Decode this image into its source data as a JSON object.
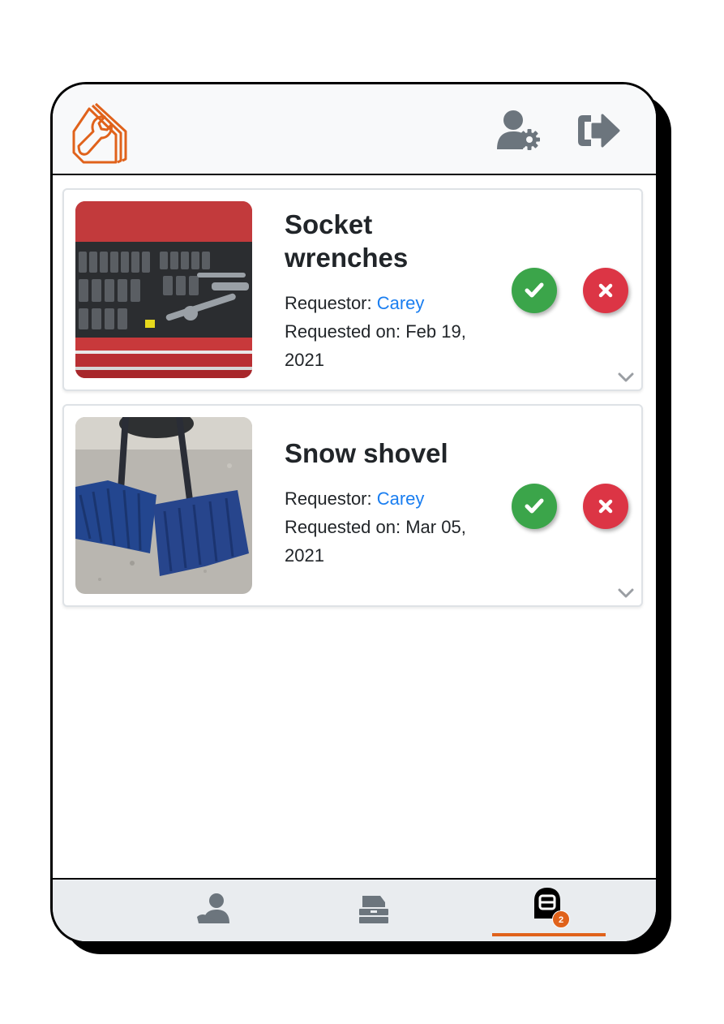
{
  "header": {
    "logo_icon": "house-wrench-logo",
    "account_icon": "user-settings-icon",
    "logout_icon": "sign-out-icon",
    "brand_color": "#e0621b"
  },
  "requests": [
    {
      "title": "Socket wrenches",
      "requestor_label": "Requestor: ",
      "requestor_name": "Carey",
      "requested_on": "Requested on: Feb 19, 2021",
      "photo": "socket-wrench-set"
    },
    {
      "title": "Snow shovel",
      "requestor_label": "Requestor: ",
      "requestor_name": "Carey",
      "requested_on": "Requested on: Mar 05, 2021",
      "photo": "snow-shovels"
    }
  ],
  "nav": {
    "tabs": [
      {
        "icon": "people-icon",
        "active": false
      },
      {
        "icon": "toolbox-icon",
        "active": false
      },
      {
        "icon": "requests-icon",
        "active": true
      }
    ],
    "badge_count": "2",
    "active_color": "#e0621b"
  }
}
